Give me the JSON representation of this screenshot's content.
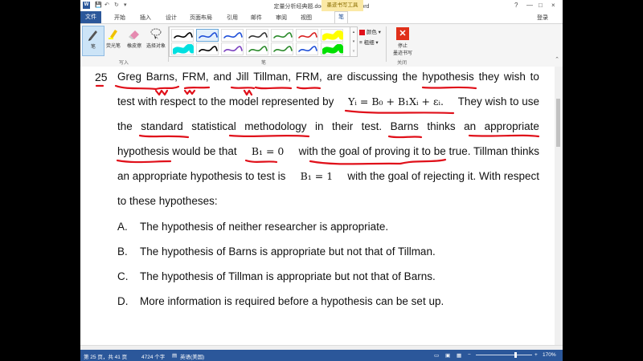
{
  "window": {
    "title": "定量分析经典题.docx - Microsoft Word",
    "app_icon": "W",
    "contextual_tab_group": "墨迹书写工具",
    "login_label": "登录",
    "help_glyph": "?",
    "controls": [
      "?",
      "—",
      "□",
      "×"
    ]
  },
  "tabs": {
    "file": "文件",
    "items": [
      "开始",
      "插入",
      "设计",
      "页面布局",
      "引用",
      "邮件",
      "审阅",
      "视图"
    ],
    "active": "笔"
  },
  "ribbon": {
    "tools": [
      {
        "label": "笔",
        "icon": "pen-icon",
        "selected": true
      },
      {
        "label": "荧光笔",
        "icon": "highlighter-icon",
        "selected": false
      },
      {
        "label": "橡皮擦",
        "icon": "eraser-icon",
        "selected": false
      },
      {
        "label": "选择对象",
        "icon": "lasso-select-icon",
        "selected": false
      }
    ],
    "group_write": "写入",
    "group_pens": "笔",
    "group_close": "关闭",
    "color_label": "颜色",
    "thickness_label": "粗细",
    "stop_label_1": "停止",
    "stop_label_2": "墨迹书写",
    "pen_colors": [
      "#000000",
      "#1f4fd8",
      "#1f4fd8",
      "#333333",
      "#2a8a2a",
      "#d82020",
      "#ffff00",
      "#00e0e0",
      "#000000",
      "#7a3fbf",
      "#2a8a2a",
      "#2a8a2a",
      "#1f4fd8",
      "#00e000",
      "#ff20ff"
    ],
    "selected_pen_index": 1
  },
  "document": {
    "question_number": "25",
    "line1_words": [
      "Greg",
      "Barns,",
      "FRM,",
      "and",
      "Jill",
      "Tillman,",
      "FRM,",
      "are",
      "discussing",
      "the",
      "hypothesis",
      "they",
      "wish",
      "to"
    ],
    "line2_pre": "test with respect to the model represented by",
    "line2_math": "Yᵢ = B₀ + B₁Xᵢ + εᵢ.",
    "line2_post": "They wish to use",
    "line3_words": [
      "the",
      "standard",
      "statistical",
      "methodology",
      "in",
      "their",
      "test.",
      "Barns",
      "thinks",
      "an",
      "appropriate"
    ],
    "line4_pre": "hypothesis would be that",
    "line4_math": "B₁ = 0",
    "line4_post": "with the goal of proving it to be true. Tillman thinks",
    "line5_pre": "an appropriate hypothesis to test is",
    "line5_math": "B₁ = 1",
    "line5_post": "with the goal of rejecting it. With respect",
    "line6": "to these hypotheses:",
    "options": [
      {
        "letter": "A.",
        "text": "The hypothesis of neither researcher is appropriate."
      },
      {
        "letter": "B.",
        "text": "The hypothesis of Barns is appropriate but not that of Tillman."
      },
      {
        "letter": "C.",
        "text": "The hypothesis of Tillman is appropriate but not that of Barns."
      },
      {
        "letter": "D.",
        "text": "More information is required before a hypothesis can be set up."
      }
    ],
    "ink_color": "#e0101a"
  },
  "status": {
    "page": "第 25 页，共 41 页",
    "words": "4724 个字",
    "language": "英语(美国)",
    "zoom": "170%"
  }
}
